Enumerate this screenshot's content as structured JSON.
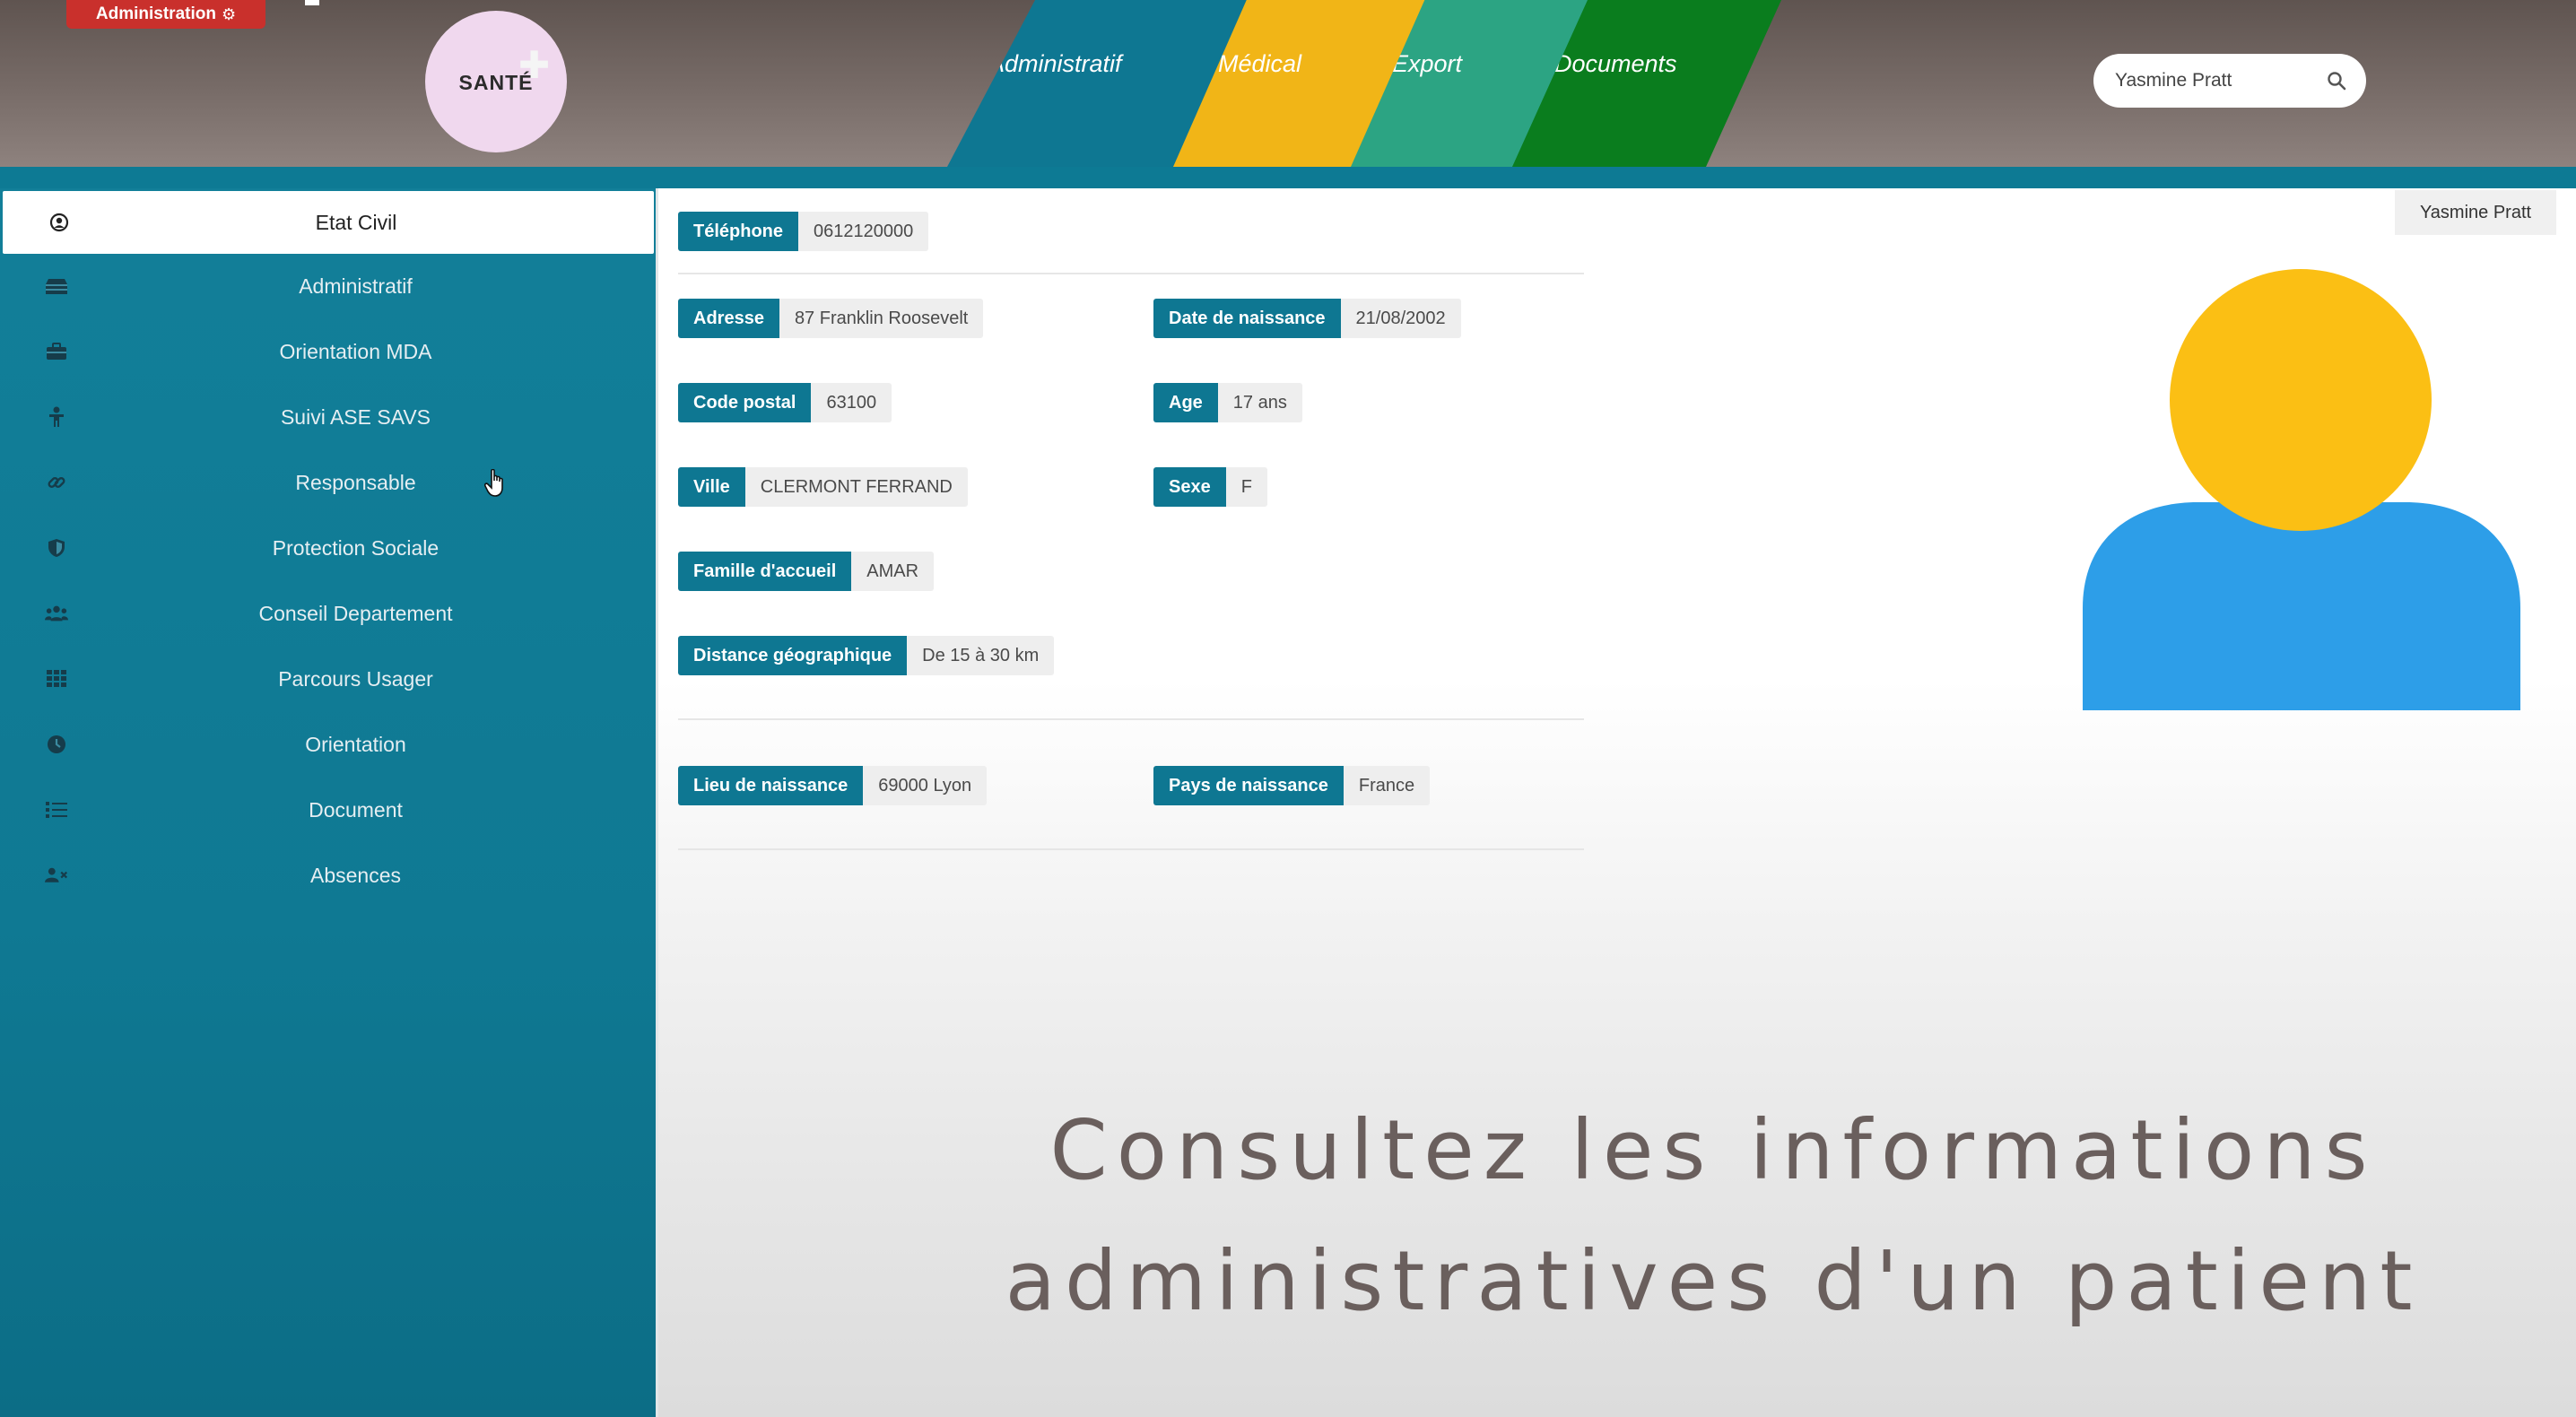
{
  "header": {
    "admin_label": "Administration",
    "logo_text": "SANTÉ",
    "tabs": [
      {
        "label": "Administratif",
        "color": "#0e7792"
      },
      {
        "label": "Médical",
        "color": "#f1b517"
      },
      {
        "label": "Export",
        "color": "#2ca483"
      },
      {
        "label": "Documents",
        "color": "#0a7d1e"
      }
    ],
    "search_value": "Yasmine Pratt"
  },
  "sidebar": {
    "items": [
      {
        "label": "Etat Civil",
        "icon": "user-circle-icon",
        "active": true
      },
      {
        "label": "Administratif",
        "icon": "archive-icon"
      },
      {
        "label": "Orientation MDA",
        "icon": "briefcase-icon"
      },
      {
        "label": "Suivi ASE SAVS",
        "icon": "child-icon"
      },
      {
        "label": "Responsable",
        "icon": "link-icon"
      },
      {
        "label": "Protection Sociale",
        "icon": "shield-icon"
      },
      {
        "label": "Conseil Departement",
        "icon": "users-icon"
      },
      {
        "label": "Parcours Usager",
        "icon": "grid-icon"
      },
      {
        "label": "Orientation",
        "icon": "clock-icon"
      },
      {
        "label": "Document",
        "icon": "list-icon"
      },
      {
        "label": "Absences",
        "icon": "user-x-icon"
      }
    ]
  },
  "patient": {
    "name": "Yasmine Pratt",
    "telephone": {
      "label": "Téléphone",
      "value": "0612120000"
    },
    "adresse": {
      "label": "Adresse",
      "value": "87 Franklin Roosevelt"
    },
    "date_naissance": {
      "label": "Date de naissance",
      "value": "21/08/2002"
    },
    "code_postal": {
      "label": "Code postal",
      "value": "63100"
    },
    "age": {
      "label": "Age",
      "value": "17 ans"
    },
    "ville": {
      "label": "Ville",
      "value": "CLERMONT FERRAND"
    },
    "sexe": {
      "label": "Sexe",
      "value": "F"
    },
    "famille": {
      "label": "Famille d'accueil",
      "value": "AMAR"
    },
    "distance": {
      "label": "Distance géographique",
      "value": "De 15 à 30 km"
    },
    "lieu_naissance": {
      "label": "Lieu de naissance",
      "value": "69000 Lyon"
    },
    "pays_naissance": {
      "label": "Pays de naissance",
      "value": "France"
    }
  },
  "caption": {
    "line1": "Consultez les informations",
    "line2": "administratives d'un patient"
  },
  "colors": {
    "primary": "#0e7792",
    "admin_badge": "#c9302c",
    "avatar_head": "#fbbf14",
    "avatar_body": "#2d9ee8"
  }
}
